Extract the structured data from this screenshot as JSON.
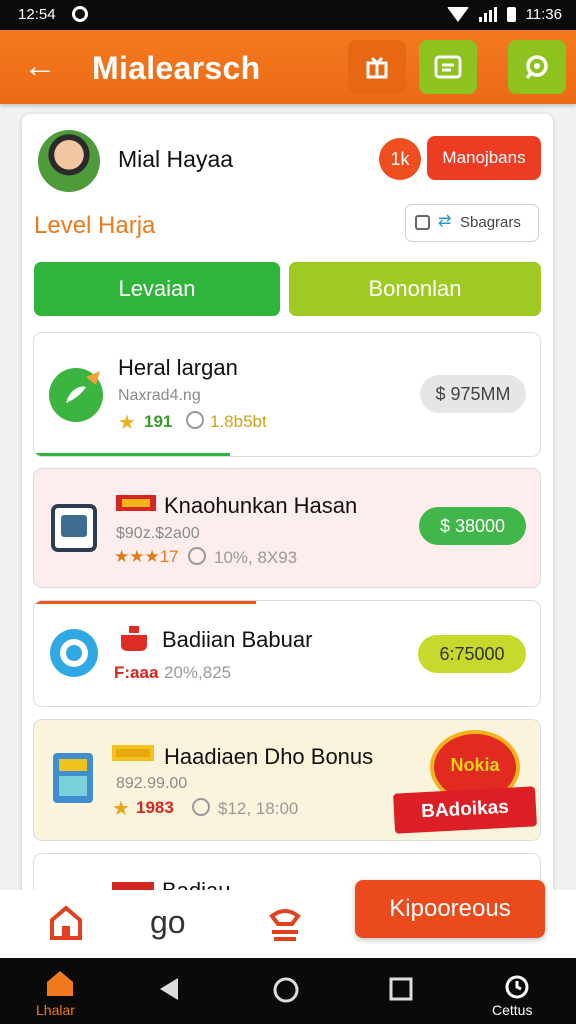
{
  "status_bar": {
    "time": "12:54",
    "time_right": "11:36"
  },
  "app_bar": {
    "title": "Mialearsch"
  },
  "profile": {
    "name": "Mial Hayaa",
    "rank_badge": "1k",
    "manage_label": "Manojbans"
  },
  "level": {
    "label": "Level Harja",
    "search_value": "Sbagrars"
  },
  "tabs": {
    "left": "Levaian",
    "right": "Bononlan"
  },
  "items": [
    {
      "title": "Heral largan",
      "subtitle": "Naxrad4.ng",
      "meta_left": "191",
      "meta_right": "1.8b5bt",
      "price": "$ 975MM"
    },
    {
      "title": "Knaohunkan Hasan",
      "subtitle": "$90z.$2a00",
      "meta_left": "★★★17",
      "meta_right": "10%, 8X93",
      "price": "$ 38000"
    },
    {
      "title": "Badiian  Babuar",
      "subtitle": "F:aaa",
      "meta_left": "",
      "meta_right": "20%,825",
      "price": "6:75000"
    },
    {
      "title": "Haadiaen Dho Bonus",
      "subtitle": "892.99.00",
      "meta_left": "1983",
      "meta_right": "$12, 18:00",
      "price": "BAdoikas",
      "promo_top": "Nokia"
    },
    {
      "title": "Badiau"
    }
  ],
  "bottom_bar": {
    "middle_label": "go",
    "fab_label": "Kipooreous"
  },
  "nav_bar": {
    "left_label": "Lhalar",
    "right_label": "Cettus"
  },
  "colors": {
    "accent": "#ec6a16",
    "green": "#30b53c",
    "lime": "#9fca22",
    "red": "#ec3c24"
  }
}
